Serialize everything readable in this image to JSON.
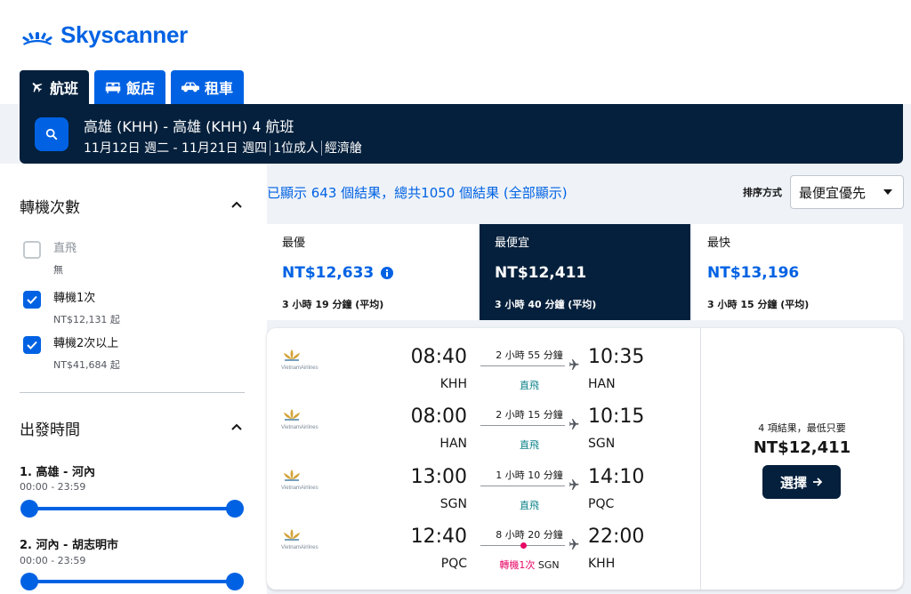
{
  "brand": {
    "name": "Skyscanner",
    "color": "#0062e3",
    "dark": "#05203c"
  },
  "tabs": [
    {
      "label": "航班",
      "icon": "plane-icon",
      "active": true
    },
    {
      "label": "飯店",
      "icon": "bed-icon",
      "active": false
    },
    {
      "label": "租車",
      "icon": "car-icon",
      "active": false
    }
  ],
  "search": {
    "route": "高雄 (KHH) - 高雄 (KHH) 4 航班",
    "dates": "11月12日 週二 - 11月21日 週四",
    "travellers": "1位成人",
    "cabin": "經濟艙"
  },
  "filters": {
    "stops": {
      "title": "轉機次數",
      "options": [
        {
          "label": "直飛",
          "sub": "無",
          "checked": false,
          "disabled": true
        },
        {
          "label": "轉機1次",
          "sub": "NT$12,131 起",
          "checked": true,
          "disabled": false
        },
        {
          "label": "轉機2次以上",
          "sub": "NT$41,684 起",
          "checked": true,
          "disabled": false
        }
      ]
    },
    "departure_times": {
      "title": "出發時間",
      "legs": [
        {
          "title": "1. 高雄 - 河內",
          "range": "00:00 - 23:59"
        },
        {
          "title": "2. 河內 - 胡志明市",
          "range": "00:00 - 23:59"
        }
      ]
    }
  },
  "results": {
    "summary": "已顯示 643 個結果，總共1050 個結果 (全部顯示)",
    "sort_label": "排序方式",
    "sort_value": "最便宜優先"
  },
  "sort_tabs": [
    {
      "label": "最優",
      "price": "NT$12,633",
      "duration": "3 小時 19 分鐘 (平均)",
      "active": false,
      "info": true
    },
    {
      "label": "最便宜",
      "price": "NT$12,411",
      "duration": "3 小時 40 分鐘 (平均)",
      "active": true,
      "info": false
    },
    {
      "label": "最快",
      "price": "NT$13,196",
      "duration": "3 小時 15 分鐘 (平均)",
      "active": false,
      "info": false
    }
  ],
  "itinerary": {
    "legs": [
      {
        "airline": "VietnamAirlines",
        "dep_time": "08:40",
        "dep_code": "KHH",
        "arr_time": "10:35",
        "arr_code": "HAN",
        "duration": "2 小時 55 分鐘",
        "stops": "直飛",
        "stop_airport": ""
      },
      {
        "airline": "VietnamAirlines",
        "dep_time": "08:00",
        "dep_code": "HAN",
        "arr_time": "10:15",
        "arr_code": "SGN",
        "duration": "2 小時 15 分鐘",
        "stops": "直飛",
        "stop_airport": ""
      },
      {
        "airline": "VietnamAirlines",
        "dep_time": "13:00",
        "dep_code": "SGN",
        "arr_time": "14:10",
        "arr_code": "PQC",
        "duration": "1 小時 10 分鐘",
        "stops": "直飛",
        "stop_airport": ""
      },
      {
        "airline": "VietnamAirlines",
        "dep_time": "12:40",
        "dep_code": "PQC",
        "arr_time": "22:00",
        "arr_code": "KHH",
        "duration": "8 小時 20 分鐘",
        "stops": "轉機1次",
        "stop_airport": "SGN"
      }
    ],
    "deals_text": "4 項結果，最低只要",
    "price": "NT$12,411",
    "select_label": "選擇"
  }
}
